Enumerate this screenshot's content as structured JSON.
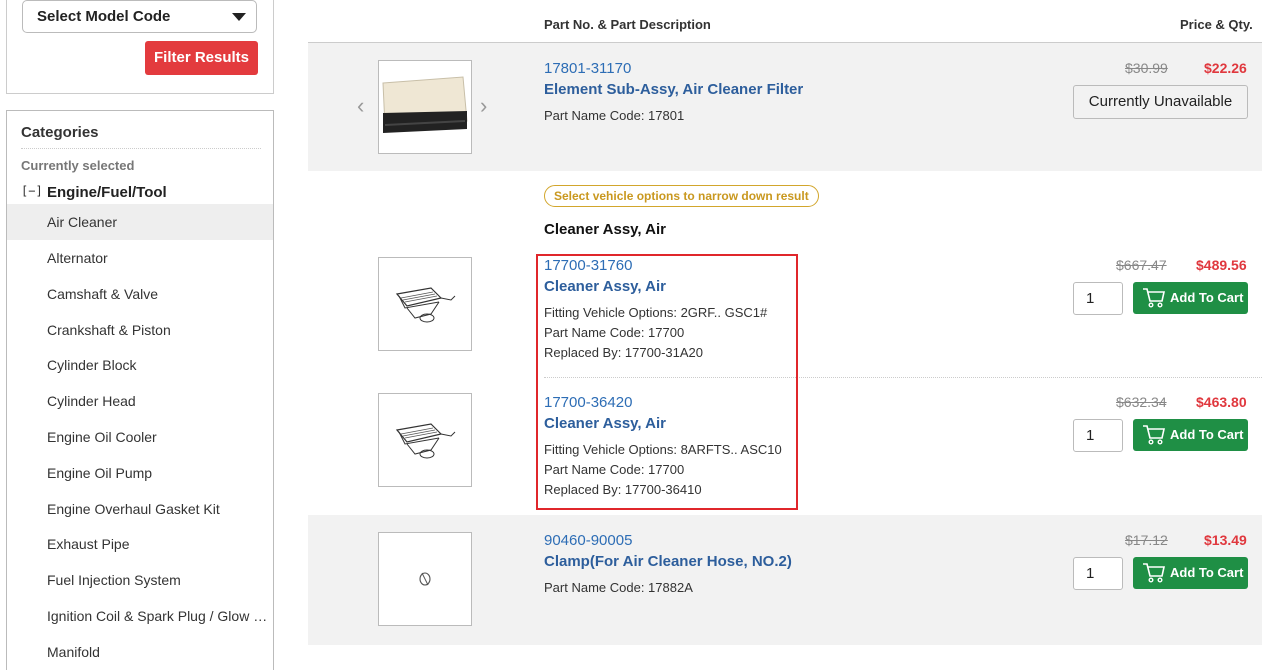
{
  "sidebar": {
    "model_select": "Select Model Code",
    "filter_button": "Filter Results",
    "categories_title": "Categories",
    "currently_selected": "Currently selected",
    "collapse_symbol": "[−]",
    "selected_category": "Engine/Fuel/Tool",
    "items": [
      {
        "label": "Air Cleaner",
        "active": true
      },
      {
        "label": "Alternator"
      },
      {
        "label": "Camshaft & Valve"
      },
      {
        "label": "Crankshaft & Piston"
      },
      {
        "label": "Cylinder Block"
      },
      {
        "label": "Cylinder Head"
      },
      {
        "label": "Engine Oil Cooler"
      },
      {
        "label": "Engine Oil Pump"
      },
      {
        "label": "Engine Overhaul Gasket Kit"
      },
      {
        "label": "Exhaust Pipe"
      },
      {
        "label": "Fuel Injection System"
      },
      {
        "label": "Ignition Coil & Spark Plug / Glow P…"
      },
      {
        "label": "Manifold"
      }
    ]
  },
  "table": {
    "col_part": "Part No. & Part Description",
    "col_price": "Price & Qty."
  },
  "parts": [
    {
      "part_no": "17801-31170",
      "name": "Element Sub-Assy, Air Cleaner Filter",
      "name_code": "Part Name Code: 17801",
      "old_price": "$30.99",
      "new_price": "$22.26",
      "status": "Currently Unavailable"
    },
    {
      "part_no": "17700-31760",
      "name": "Cleaner Assy, Air",
      "options": "Fitting Vehicle Options: 2GRF.. GSC1#",
      "name_code": "Part Name Code: 17700",
      "replaced": "Replaced By: 17700-31A20",
      "old_price": "$667.47",
      "new_price": "$489.56",
      "qty": "1",
      "cart_label": "Add To Cart"
    },
    {
      "part_no": "17700-36420",
      "name": "Cleaner Assy, Air",
      "options": "Fitting Vehicle Options: 8ARFTS.. ASC10",
      "name_code": "Part Name Code: 17700",
      "replaced": "Replaced By: 17700-36410",
      "old_price": "$632.34",
      "new_price": "$463.80",
      "qty": "1",
      "cart_label": "Add To Cart"
    },
    {
      "part_no": "90460-90005",
      "name": "Clamp(For Air Cleaner Hose, NO.2)",
      "name_code": "Part Name Code: 17882A",
      "old_price": "$17.12",
      "new_price": "$13.49",
      "qty": "1",
      "cart_label": "Add To Cart"
    }
  ],
  "group": {
    "badge": "Select vehicle options to narrow down result",
    "title": "Cleaner Assy, Air"
  },
  "colors": {
    "accent_red": "#e33b3e",
    "cart_green": "#1f8f45",
    "link_blue": "#2d6db5",
    "badge_gold": "#c9981f"
  }
}
